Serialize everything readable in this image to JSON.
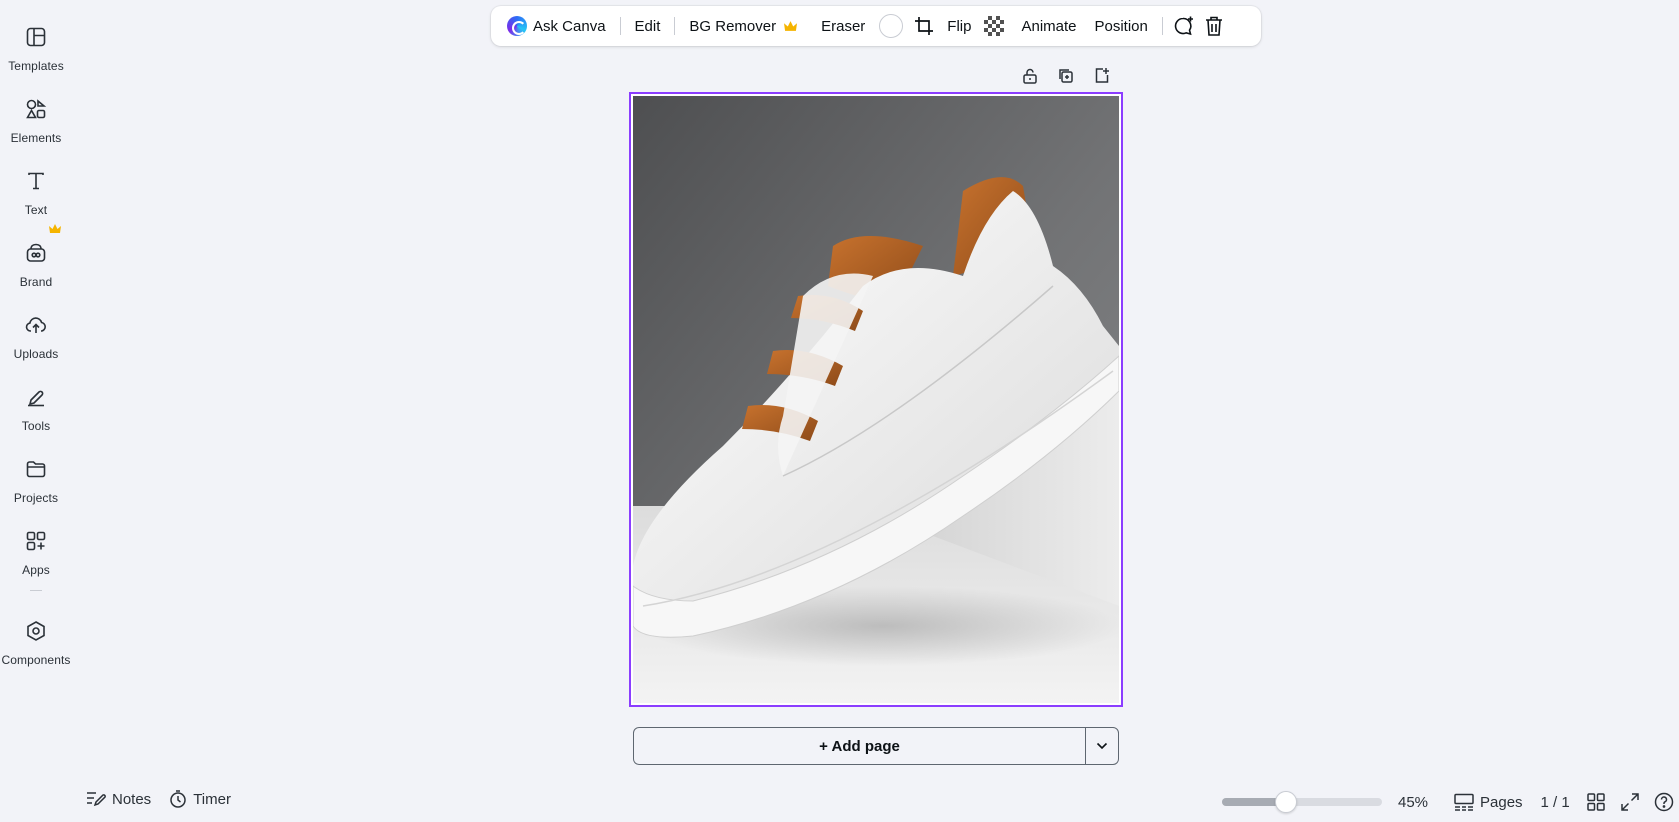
{
  "sidebar": {
    "items": [
      {
        "label": "Templates",
        "icon": "templates-icon"
      },
      {
        "label": "Elements",
        "icon": "elements-icon"
      },
      {
        "label": "Text",
        "icon": "text-icon"
      },
      {
        "label": "Brand",
        "icon": "brand-icon",
        "premium": true
      },
      {
        "label": "Uploads",
        "icon": "uploads-icon"
      },
      {
        "label": "Tools",
        "icon": "tools-icon"
      },
      {
        "label": "Projects",
        "icon": "projects-icon"
      },
      {
        "label": "Apps",
        "icon": "apps-icon"
      },
      {
        "label": "Components",
        "icon": "components-icon"
      }
    ]
  },
  "toolbar": {
    "ask_canva": "Ask Canva",
    "edit": "Edit",
    "bg_remover": "BG Remover",
    "eraser": "Eraser",
    "flip": "Flip",
    "animate": "Animate",
    "position": "Position"
  },
  "canvas": {
    "content": "white-sneaker-photo",
    "selection_color": "#8b3dff"
  },
  "add_page": {
    "label": "+ Add page"
  },
  "bottom": {
    "notes": "Notes",
    "timer": "Timer",
    "zoom": "45%",
    "zoom_fraction": 0.45,
    "pages": "Pages",
    "page_count": "1 / 1"
  },
  "colors": {
    "accent": "#8b3dff",
    "premium": "#f5b400",
    "background": "#f2f3f8"
  }
}
